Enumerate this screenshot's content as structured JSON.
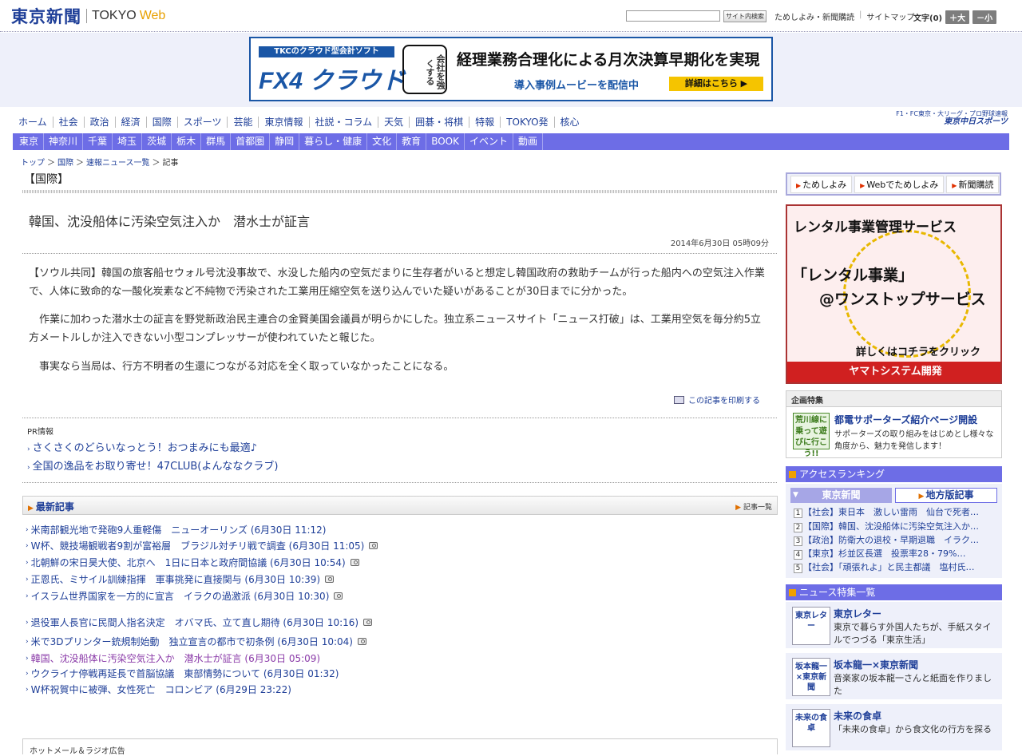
{
  "header": {
    "logo_ja": "東京新聞",
    "logo_en1": "TOKYO",
    "logo_en2": "Web",
    "search_button": "サイト内検索",
    "links": [
      "ためしよみ・新聞購読",
      "サイトマップ"
    ],
    "font_size_label": "文字(0)",
    "font_larger": "＋大",
    "font_smaller": "－小"
  },
  "ad_banner": {
    "tag": "TKCのクラウド型会計ソフト",
    "product": "FX4 クラウド",
    "stamp": "会社を強くする",
    "headline": "経理業務合理化による月次決算早期化を実現",
    "sub": "導入事例ムービーを配信中",
    "button": "詳細はこちら ▶"
  },
  "nav_primary": [
    "ホーム",
    "社会",
    "政治",
    "経済",
    "国際",
    "スポーツ",
    "芸能",
    "東京情報",
    "社説・コラム",
    "天気",
    "囲碁・将棋",
    "特報",
    "TOKYO発",
    "核心"
  ],
  "chunichi": {
    "line1": "F1・FC東京・大リーグ・プロ野球速報",
    "line2": "東京中日スポーツ"
  },
  "nav_secondary": [
    "東京",
    "神奈川",
    "千葉",
    "埼玉",
    "茨城",
    "栃木",
    "群馬",
    "首都圏",
    "静岡",
    "暮らし・健康",
    "文化",
    "教育",
    "BOOK",
    "イベント",
    "動画"
  ],
  "breadcrumb": {
    "items": [
      "トップ",
      "国際",
      "速報ニュース一覧"
    ],
    "current": "記事",
    "sep": "＞"
  },
  "section_title": "【国際】",
  "article": {
    "headline": "韓国、沈没船体に汚染空気注入か　潜水士が証言",
    "date": "2014年6月30日 05時09分",
    "paragraphs": [
      "【ソウル共同】韓国の旅客船セウォル号沈没事故で、水没した船内の空気だまりに生存者がいると想定し韓国政府の救助チームが行った船内への空気注入作業で、人体に致命的な一酸化炭素など不純物で汚染された工業用圧縮空気を送り込んでいた疑いがあることが30日までに分かった。",
      "作業に加わった潜水士の証言を野党新政治民主連合の金賢美国会議員が明らかにした。独立系ニュースサイト「ニュース打破」は、工業用空気を毎分約5立方メートルしか注入できない小型コンプレッサーが使われていたと報じた。",
      "事実なら当局は、行方不明者の生還につながる対応を全く取っていなかったことになる。"
    ],
    "print_link": "この記事を印刷する"
  },
  "pr": {
    "title": "PR情報",
    "items": [
      "さくさくのどらいなっとう！おつまみにも最適♪",
      "全国の逸品をお取り寄せ！47CLUB(よんななクラブ)"
    ]
  },
  "latest": {
    "title": "最新記事",
    "index_label": "記事一覧",
    "items": [
      {
        "text": "米南部観光地で発砲9人重軽傷　ニューオーリンズ (6月30日 11:12)",
        "photo": false,
        "visited": false
      },
      {
        "text": "W杯、競技場観戦者9割が富裕層　ブラジル対チリ戦で調査 (6月30日 11:05)",
        "photo": true,
        "visited": false
      },
      {
        "text": "北朝鮮の宋日昊大使、北京へ　1日に日本と政府間協議 (6月30日 10:54)",
        "photo": true,
        "visited": false
      },
      {
        "text": "正恩氏、ミサイル訓練指揮　軍事挑発に直接関与 (6月30日 10:39)",
        "photo": true,
        "visited": false
      },
      {
        "text": "イスラム世界国家を一方的に宣言　イラクの過激派 (6月30日 10:30)",
        "photo": true,
        "visited": false
      },
      {
        "text": "退役軍人長官に民間人指名決定　オバマ氏、立て直し期待 (6月30日 10:16)",
        "photo": true,
        "visited": false
      },
      {
        "text": "米で3Dプリンター銃規制始動　独立宣言の都市で初条例 (6月30日 10:04)",
        "photo": true,
        "visited": false
      },
      {
        "text": "韓国、沈没船体に汚染空気注入か　潜水士が証言 (6月30日 05:09)",
        "photo": false,
        "visited": true
      },
      {
        "text": "ウクライナ停戦再延長で首脳協議　東部情勢について (6月30日 01:32)",
        "photo": false,
        "visited": false
      },
      {
        "text": "W杯祝賀中に被弾、女性死亡　コロンビア (6月29日 23:22)",
        "photo": false,
        "visited": false
      }
    ]
  },
  "bottom_box": "ホットメール＆ラジオ広告",
  "sidebar": {
    "quick_links": [
      "ためしよみ",
      "Webでためしよみ",
      "新聞購読"
    ],
    "yamato_ad": {
      "top": "レンタル事業管理サービス",
      "mid1": "「レンタル事業」",
      "mid2": "@ワンストップサービス",
      "click": "詳しくはコチラをクリック",
      "foot": "ヤマトシステム開発"
    },
    "kikaku": {
      "title": "企画特集",
      "thumb": "荒川線に乗って遊びに行こう!!",
      "item_title": "都電サポーターズ紹介ページ開設",
      "item_desc": "サポーターズの取り組みをはじめとし様々な角度から、魅力を発信します！"
    },
    "ranking": {
      "title": "アクセスランキング",
      "tab_tokyo": "東京新聞",
      "tab_local": "地方版記事",
      "items": [
        "【社会】東日本　激しい雷雨　仙台で死者…",
        "【国際】韓国、沈没船体に汚染空気注入か…",
        "【政治】防衛大の退校・早期退職　イラク…",
        "【東京】杉並区長選　投票率28・79%…",
        "【社会】「頑張れよ」と民主都議　塩村氏…"
      ]
    },
    "news_special": {
      "title": "ニュース特集一覧",
      "items": [
        {
          "thumb": "東京レター",
          "title": "東京レター",
          "desc": "東京で暮らす外国人たちが、手紙スタイルでつづる「東京生活」"
        },
        {
          "thumb": "坂本龍一×東京新聞",
          "title": "坂本龍一×東京新聞",
          "desc": "音楽家の坂本龍一さんと紙面を作りました"
        },
        {
          "thumb": "未来の食卓",
          "title": "未来の食卓",
          "desc": "「未来の食卓」から食文化の行方を探る"
        }
      ]
    }
  }
}
